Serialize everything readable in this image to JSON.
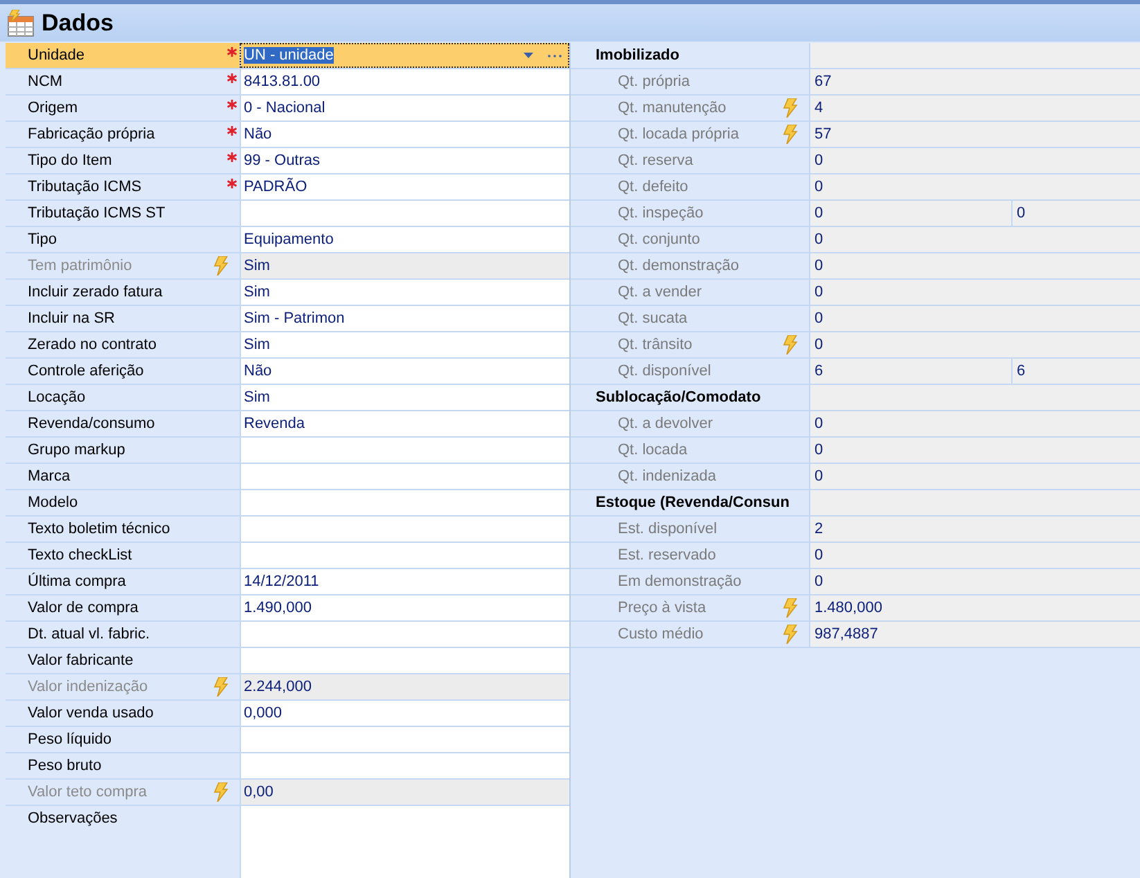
{
  "panel": {
    "title": "Dados"
  },
  "fields": [
    {
      "label": "Unidade",
      "value": "UN - unidade",
      "required": true,
      "lightning": false,
      "disabled": false,
      "selected": true
    },
    {
      "label": "NCM",
      "value": "8413.81.00",
      "required": true,
      "lightning": false,
      "disabled": false,
      "selected": false
    },
    {
      "label": "Origem",
      "value": "0 - Nacional",
      "required": true,
      "lightning": false,
      "disabled": false,
      "selected": false
    },
    {
      "label": "Fabricação própria",
      "value": "Não",
      "required": true,
      "lightning": false,
      "disabled": false,
      "selected": false
    },
    {
      "label": "Tipo do Item",
      "value": "99 - Outras",
      "required": true,
      "lightning": false,
      "disabled": false,
      "selected": false
    },
    {
      "label": "Tributação ICMS",
      "value": "PADRÃO",
      "required": true,
      "lightning": false,
      "disabled": false,
      "selected": false
    },
    {
      "label": "Tributação ICMS ST",
      "required": false,
      "lightning": false,
      "disabled": false,
      "selected": false
    },
    {
      "label": "Tipo",
      "value": "Equipamento",
      "required": false,
      "lightning": false,
      "disabled": false,
      "selected": false
    },
    {
      "label": "Tem patrimônio",
      "value": "Sim",
      "required": false,
      "lightning": true,
      "disabled": true,
      "selected": false
    },
    {
      "label": "Incluir zerado fatura",
      "value": "Sim",
      "required": false,
      "lightning": false,
      "disabled": false,
      "selected": false
    },
    {
      "label": "Incluir na SR",
      "value": "Sim - Patrimon",
      "required": false,
      "lightning": false,
      "disabled": false,
      "selected": false
    },
    {
      "label": "Zerado no contrato",
      "value": "Sim",
      "required": false,
      "lightning": false,
      "disabled": false,
      "selected": false
    },
    {
      "label": "Controle aferição",
      "value": "Não",
      "required": false,
      "lightning": false,
      "disabled": false,
      "selected": false
    },
    {
      "label": "Locação",
      "value": "Sim",
      "required": false,
      "lightning": false,
      "disabled": false,
      "selected": false
    },
    {
      "label": "Revenda/consumo",
      "value": "Revenda",
      "required": false,
      "lightning": false,
      "disabled": false,
      "selected": false
    },
    {
      "label": "Grupo markup",
      "required": false,
      "lightning": false,
      "disabled": false,
      "selected": false
    },
    {
      "label": "Marca",
      "required": false,
      "lightning": false,
      "disabled": false,
      "selected": false
    },
    {
      "label": "Modelo",
      "required": false,
      "lightning": false,
      "disabled": false,
      "selected": false
    },
    {
      "label": "Texto boletim técnico",
      "required": false,
      "lightning": false,
      "disabled": false,
      "selected": false
    },
    {
      "label": "Texto checkList",
      "required": false,
      "lightning": false,
      "disabled": false,
      "selected": false
    },
    {
      "label": "Última compra",
      "value": "14/12/2011",
      "required": false,
      "lightning": false,
      "disabled": false,
      "selected": false
    },
    {
      "label": "Valor de compra",
      "value": "1.490,000",
      "required": false,
      "lightning": false,
      "disabled": false,
      "selected": false
    },
    {
      "label": "Dt. atual vl. fabric.",
      "required": false,
      "lightning": false,
      "disabled": false,
      "selected": false
    },
    {
      "label": "Valor fabricante",
      "required": false,
      "lightning": false,
      "disabled": false,
      "selected": false
    },
    {
      "label": "Valor indenização",
      "value": "2.244,000",
      "required": false,
      "lightning": true,
      "disabled": true,
      "selected": false
    },
    {
      "label": "Valor venda usado",
      "value": "0,000",
      "required": false,
      "lightning": false,
      "disabled": false,
      "selected": false
    },
    {
      "label": "Peso líquido",
      "required": false,
      "lightning": false,
      "disabled": false,
      "selected": false
    },
    {
      "label": "Peso bruto",
      "required": false,
      "lightning": false,
      "disabled": false,
      "selected": false
    },
    {
      "label": "Valor teto compra",
      "value": "0,00",
      "required": false,
      "lightning": true,
      "disabled": true,
      "selected": false
    },
    {
      "label": "Observações",
      "required": false,
      "lightning": false,
      "disabled": false,
      "selected": false,
      "kind": "memo"
    }
  ],
  "summary": [
    {
      "kind": "group",
      "label": "Imobilizado"
    },
    {
      "kind": "field",
      "label": "Qt. própria",
      "value": "67",
      "lightning": false
    },
    {
      "kind": "field",
      "label": "Qt. manutenção",
      "value": "4",
      "lightning": true
    },
    {
      "kind": "field",
      "label": "Qt. locada própria",
      "value": "57",
      "lightning": true
    },
    {
      "kind": "field",
      "label": "Qt. reserva",
      "value": "0",
      "lightning": false
    },
    {
      "kind": "field",
      "label": "Qt. defeito",
      "value": "0",
      "lightning": false
    },
    {
      "kind": "field",
      "label": "Qt. inspeção",
      "value": "0",
      "value_2": "0",
      "lightning": false
    },
    {
      "kind": "field",
      "label": "Qt. conjunto",
      "value": "0",
      "lightning": false
    },
    {
      "kind": "field",
      "label": "Qt. demonstração",
      "value": "0",
      "lightning": false
    },
    {
      "kind": "field",
      "label": "Qt. a vender",
      "value": "0",
      "lightning": false
    },
    {
      "kind": "field",
      "label": "Qt. sucata",
      "value": "0",
      "lightning": false
    },
    {
      "kind": "field",
      "label": "Qt. trânsito",
      "value": "0",
      "lightning": true
    },
    {
      "kind": "field",
      "label": "Qt. disponível",
      "value": "6",
      "value_2": "6",
      "lightning": false
    },
    {
      "kind": "group",
      "label": "Sublocação/Comodato"
    },
    {
      "kind": "field",
      "label": "Qt. a devolver",
      "value": "0",
      "lightning": false
    },
    {
      "kind": "field",
      "label": "Qt. locada",
      "value": "0",
      "lightning": false
    },
    {
      "kind": "field",
      "label": "Qt. indenizada",
      "value": "0",
      "lightning": false
    },
    {
      "kind": "group",
      "label": "Estoque (Revenda/Consun"
    },
    {
      "kind": "field",
      "label": "Est. disponível",
      "value": "2",
      "lightning": false
    },
    {
      "kind": "field",
      "label": "Est. reservado",
      "value": "0",
      "lightning": false
    },
    {
      "kind": "field",
      "label": "Em demonstração",
      "value": "0",
      "lightning": false
    },
    {
      "kind": "field",
      "label": "Preço à vista",
      "value": "1.480,000",
      "lightning": true
    },
    {
      "kind": "field",
      "label": "Custo médio",
      "value": "987,4887",
      "lightning": true
    }
  ]
}
